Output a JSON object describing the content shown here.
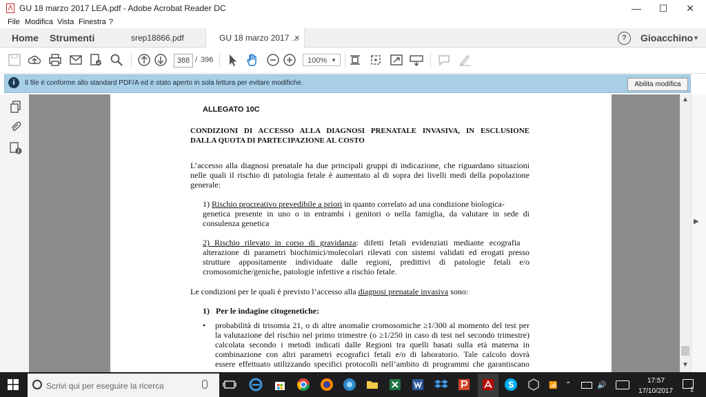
{
  "window": {
    "title": "GU 18 marzo 2017 LEA.pdf - Adobe Acrobat Reader DC",
    "minimize": "—",
    "maximize": "☐",
    "close": "✕"
  },
  "menu": [
    "File",
    "Modifica",
    "Vista",
    "Finestra",
    "?"
  ],
  "tabs": {
    "home": "Home",
    "tools": "Strumenti",
    "doc1": "srep18866.pdf",
    "doc2": "GU 18 marzo 2017 ...",
    "doc2_close": "×",
    "help": "?",
    "user": "Gioacchino"
  },
  "toolbar": {
    "page_current": "388",
    "page_sep": "/",
    "page_total": "396",
    "zoom": "100%"
  },
  "infobar": {
    "message": "Il file è conforme allo standard PDF/A ed è stato aperto in sola lettura per evitare modifiche.",
    "button": "Abilita modifica"
  },
  "document": {
    "allegato": "ALLEGATO 10C",
    "heading1": "CONDIZIONI DI ACCESSO ALLA DIAGNOSI PRENATALE INVASIVA, IN ESCLUSIONE",
    "heading2": "DALLA QUOTA DI PARTECIPAZIONE AL COSTO",
    "intro_l1": "L’accesso alla diagnosi prenatale ha due principali gruppi di indicazione, che riguardano situazioni",
    "intro_l2": "nelle quali il rischio di patologia fetale è aumentato al di sopra dei livelli medi della popolazione",
    "intro_l3": "generale:",
    "p1_prefix": "1) ",
    "p1_ul": "Rischio procreativo prevedibile a priori",
    "p1_l1_rest": " in quanto correlato ad una condizione biologica-",
    "p1_l2": "genetica presente in uno o in entrambi i genitori o nella famiglia, da valutare in sede di",
    "p1_l3": "consulenza genetica",
    "p2_ul": "2) Rischio rilevato in corso di gravidanza",
    "p2_l1_rest": ": difetti fetali evidenziati mediante ecografia",
    "p2_l2": "alterazione di parametri biochimici/molecolari rilevati con sistemi validati ed erogati presso",
    "p2_l3": "strutture appositamente individuate dalle regioni, predittivi di patologie fetali e/o",
    "p2_l4": "cromosomiche/geniche, patologie infettive a rischio fetale.",
    "cond_prefix": "Le condizioni per le quali è previsto l’accesso alla ",
    "cond_ul": "diagnosi prenatale invasiva",
    "cond_suffix": " sono:",
    "sec1": "1)   Per le indagine citogenetiche:",
    "bullet": "•",
    "b_l1": "probabilità di trisomia 21, o di altre anomalie cromosomiche  ≥1/300 al momento del test per",
    "b_l2": "la valutazione del rischio nel primo trimestre (o ≥1/250 in caso di test nel secondo trimestre)",
    "b_l3": "calcolata secondo i metodi indicati dalle Regioni  tra quelli  basati sulla età materna in",
    "b_l4": "combinazione con altri parametri ecografici fetali e/o di laboratorio. Tale calcolo dovrà",
    "b_l5": "essere effettuato utilizzando specifici protocolli nell’ambito di programmi che garantiscano"
  },
  "taskbar": {
    "search_placeholder": "Scrivi qui per eseguire la ricerca",
    "time": "17:57",
    "date": "17/10/2017",
    "notifications": "1"
  },
  "colors": {
    "info_bg": "#a9cfe6",
    "doc_bg": "#8c8c8c",
    "taskbar": "#1d1d1f"
  }
}
